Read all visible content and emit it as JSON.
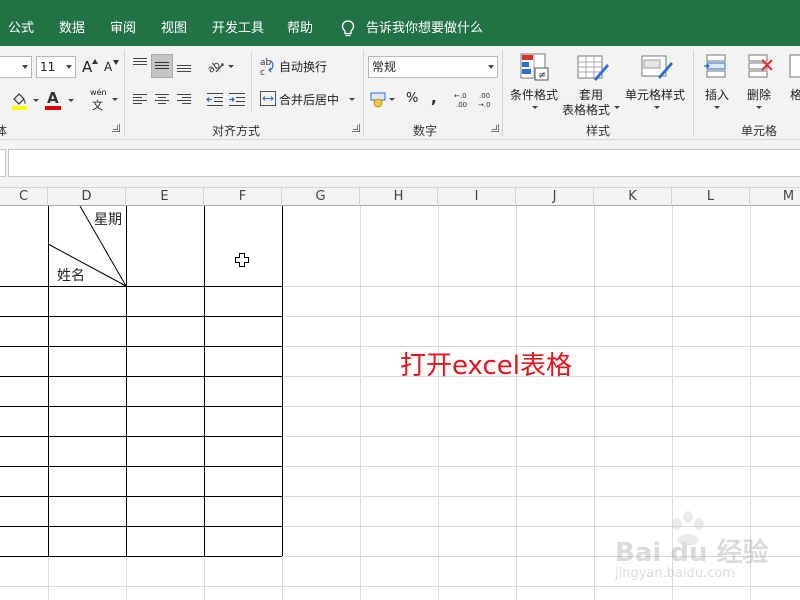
{
  "menu": {
    "tabs": [
      "公式",
      "数据",
      "审阅",
      "视图",
      "开发工具",
      "帮助"
    ],
    "tell_me": "告诉我你想要做什么"
  },
  "ribbon": {
    "font": {
      "size_value": "11",
      "grow_label": "A",
      "shrink_label": "A",
      "phonetic_label": "wén",
      "phonetic_sub": "文",
      "font_color_label": "A"
    },
    "alignment": {
      "wrap_text": "自动换行",
      "merge_center": "合并后居中",
      "group_label": "对齐方式"
    },
    "number": {
      "format_value": "常规",
      "percent": "%",
      "comma": ",",
      "group_label": "数字"
    },
    "styles": {
      "conditional": "条件格式",
      "table_format_1": "套用",
      "table_format_2": "表格格式",
      "cell_styles": "单元格样式",
      "group_label": "样式"
    },
    "cells": {
      "insert": "插入",
      "delete": "删除",
      "format": "格",
      "group_label": "单元格"
    }
  },
  "grid": {
    "columns": [
      "C",
      "D",
      "E",
      "F",
      "G",
      "H",
      "I",
      "J",
      "K",
      "L",
      "M"
    ],
    "diag_header_top": "星期",
    "diag_header_bottom": "姓名",
    "note": "打开excel表格"
  },
  "watermark": {
    "brand": "Bai du 经验",
    "url": "jingyan.baidu.com"
  },
  "colors": {
    "accent": "#217346",
    "note": "#e8141c"
  }
}
